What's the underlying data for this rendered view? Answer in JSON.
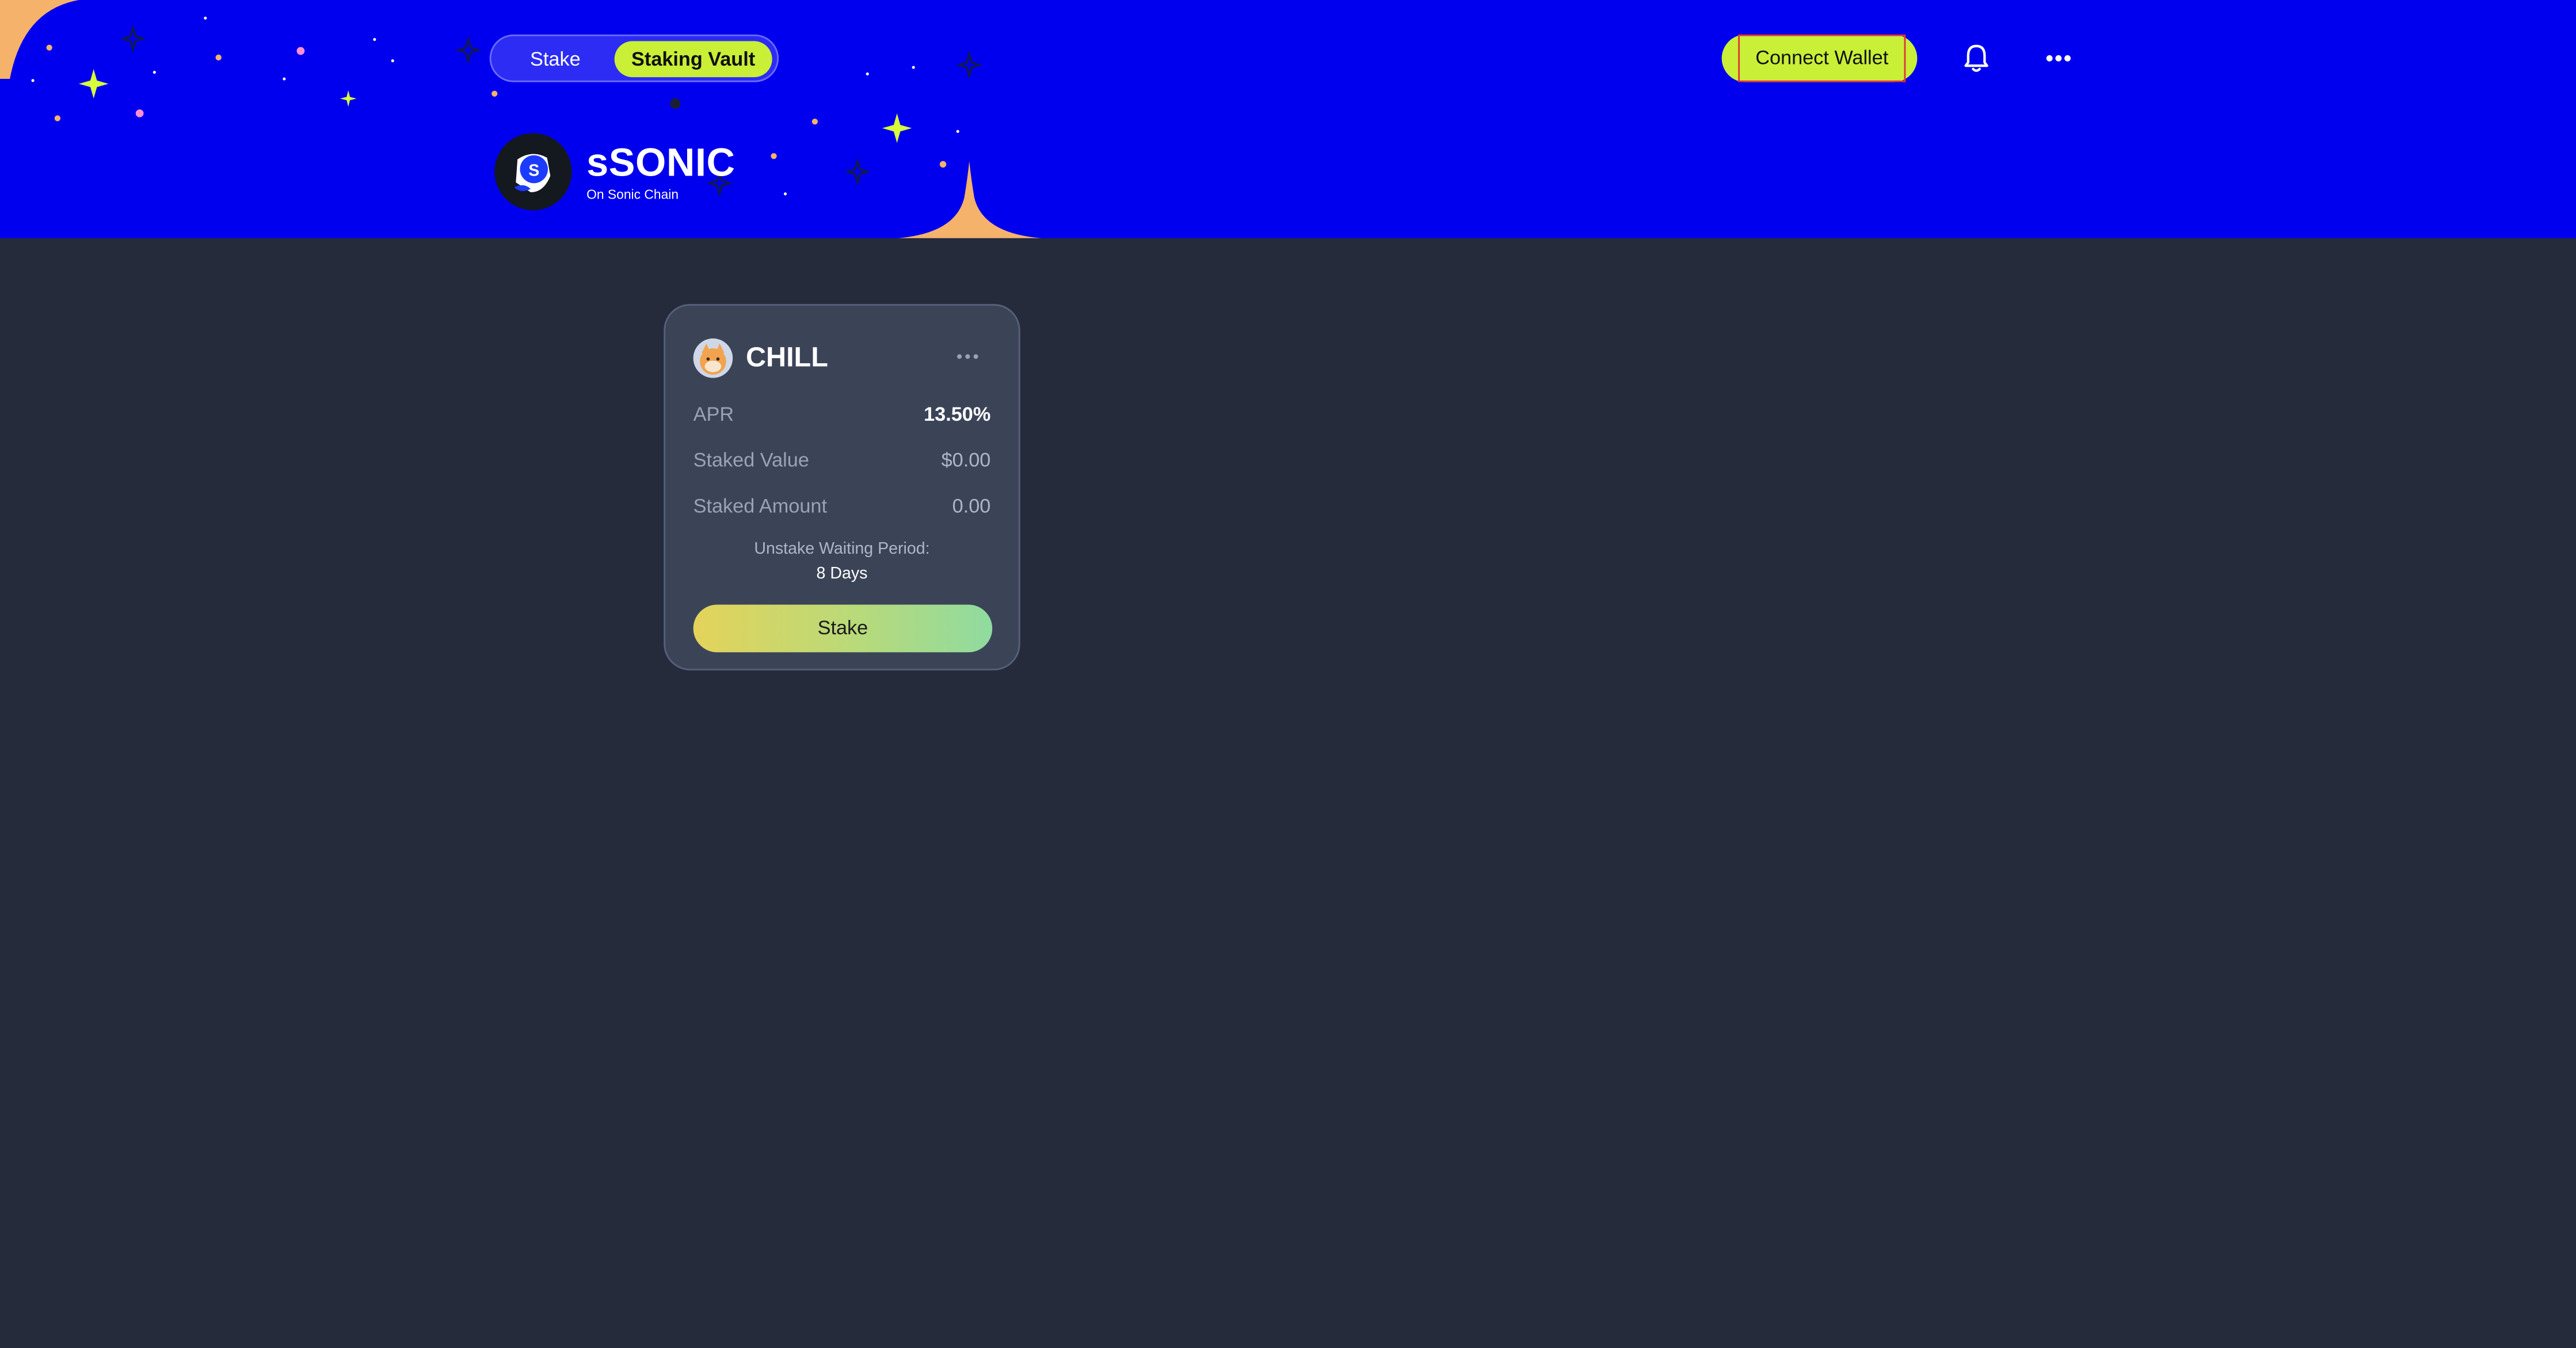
{
  "nav": {
    "tabs": [
      {
        "label": "Stake",
        "active": false
      },
      {
        "label": "Staking Vault",
        "active": true
      }
    ]
  },
  "brand": {
    "logo_letter": "S",
    "name": "sSONIC",
    "subtitle": "On Sonic Chain"
  },
  "header_actions": {
    "connect_wallet_label": "Connect Wallet",
    "notification_icon": "bell-icon",
    "more_icon": "more-horizontal-icon"
  },
  "vault_card": {
    "token_name": "CHILL",
    "token_icon": "chill-token-icon",
    "rows": [
      {
        "label": "APR",
        "value": "13.50%"
      },
      {
        "label": "Staked Value",
        "value": "$0.00"
      },
      {
        "label": "Staked Amount",
        "value": "0.00"
      }
    ],
    "unstake_label": "Unstake Waiting Period:",
    "unstake_value": "8 Days",
    "stake_button_label": "Stake"
  },
  "colors": {
    "header_bg": "#0000ee",
    "page_bg": "#252b3a",
    "card_bg": "#3b4457",
    "accent": "#c9ef37",
    "decor_orange": "#f4b26a",
    "focus_outline": "#e0373a"
  }
}
